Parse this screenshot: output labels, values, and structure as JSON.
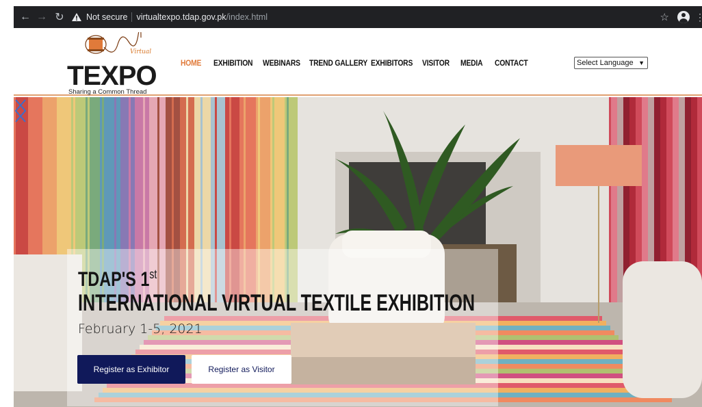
{
  "browser": {
    "security_label": "Not secure",
    "url_host": "virtualtexpo.tdap.gov.pk",
    "url_path": "/index.html",
    "icons": [
      "back-icon",
      "forward-icon",
      "reload-icon",
      "warning-icon",
      "star-icon",
      "account-icon",
      "menu-icon"
    ]
  },
  "logo": {
    "word": "TEXPO",
    "accent": "Virtual",
    "tagline": "Sharing a Common Thread"
  },
  "nav": {
    "items": [
      {
        "label": "HOME",
        "active": true
      },
      {
        "label": "EXHIBITION"
      },
      {
        "label": "WEBINARS"
      },
      {
        "label": "TREND GALLERY"
      },
      {
        "label": "EXHIBITORS"
      },
      {
        "label": "VISITOR"
      },
      {
        "label": "MEDIA"
      },
      {
        "label": "CONTACT"
      }
    ]
  },
  "language": {
    "selected": "Select Language"
  },
  "hero": {
    "title_line1": "TDAP'S 1",
    "title_sup": "st",
    "title_line2": "INTERNATIONAL VIRTUAL TEXTILE EXHIBITION",
    "date": "February 1-5, 2021",
    "btn_exhibitor": "Register as Exhibitor",
    "btn_visitor": "Register as Visitor"
  },
  "colors": {
    "accent_orange": "#e07a3a",
    "button_navy": "#10195a",
    "chrome_dark": "#202124"
  }
}
